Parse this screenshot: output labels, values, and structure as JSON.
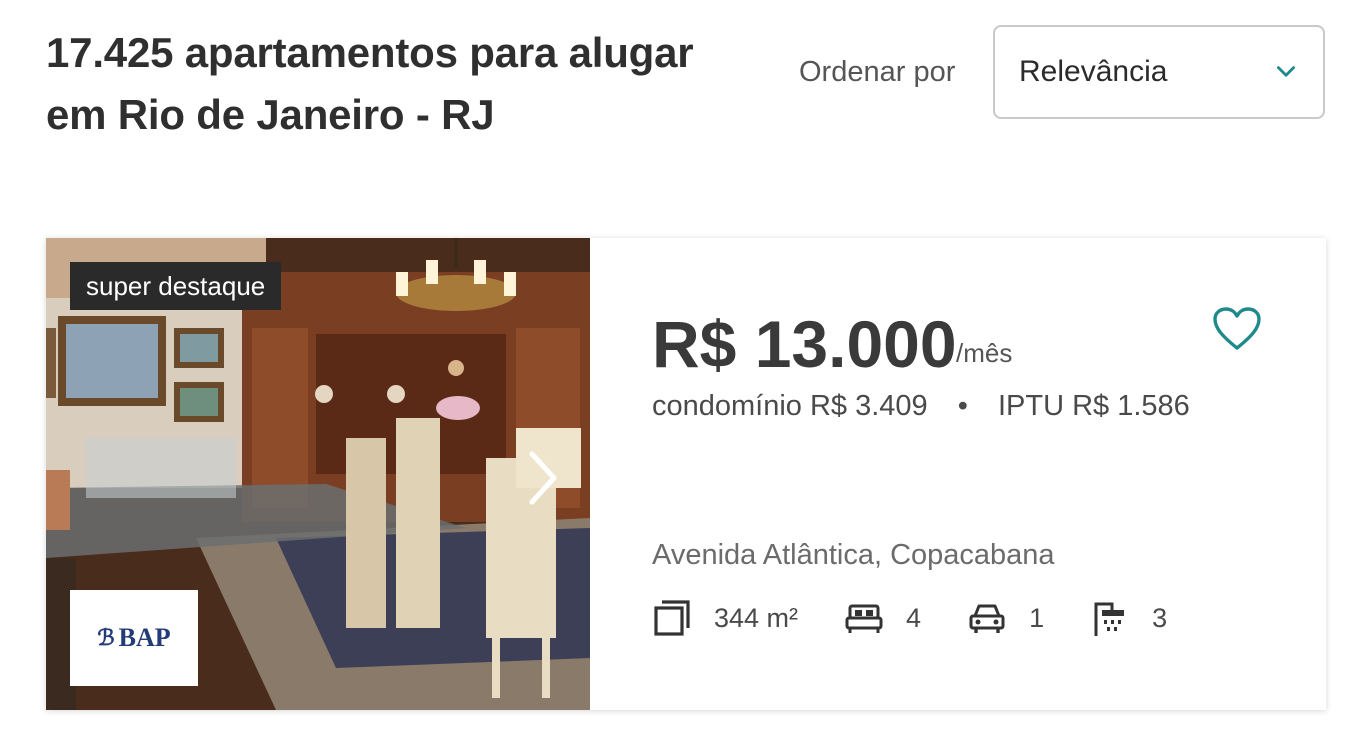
{
  "header": {
    "title": "17.425 apartamentos para alugar em Rio de Janeiro - RJ",
    "sort_label": "Ordenar por",
    "sort_value": "Relevância"
  },
  "listing": {
    "badge": "super destaque",
    "agency_logo_text": "BAP",
    "price": "R$ 13.000",
    "price_unit": "/mês",
    "condo_fee": "condomínio R$ 3.409",
    "fee_separator": "•",
    "iptu": "IPTU R$ 1.586",
    "address": "Avenida Atlântica, Copacabana",
    "features": {
      "area": "344 m²",
      "bedrooms": "4",
      "parking": "1",
      "bathrooms": "3"
    }
  },
  "colors": {
    "accent": "#1f8a8a",
    "badge_bg": "#2a2a2a",
    "text_dark": "#2f2f2f"
  },
  "icons": {
    "sort": "chevron-down-icon",
    "next": "chevron-right-icon",
    "favorite": "heart-icon",
    "area": "area-icon",
    "bedrooms": "bed-icon",
    "parking": "car-icon",
    "bathrooms": "shower-icon"
  }
}
